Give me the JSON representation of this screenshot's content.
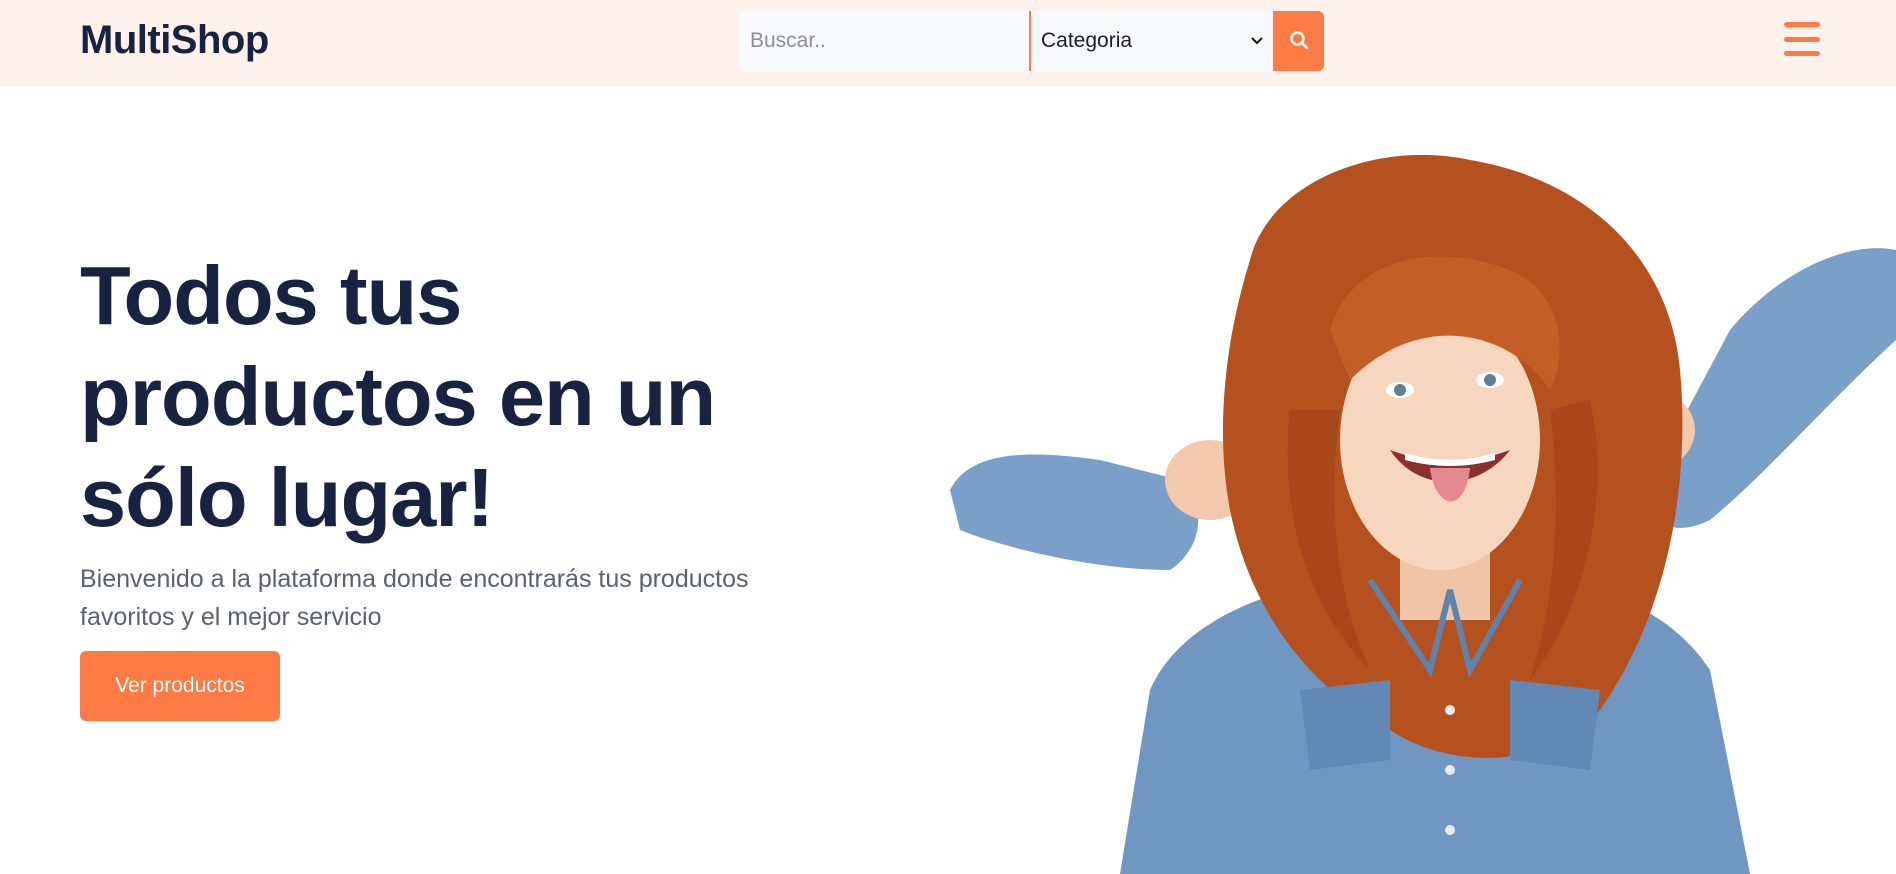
{
  "brand": {
    "name": "MultiShop"
  },
  "search": {
    "placeholder": "Buscar..",
    "category_selected": "Categoria"
  },
  "hero": {
    "title": "Todos tus productos en un sólo lugar!",
    "subtitle": "Bienvenido a la plataforma donde encontrarás tus productos favoritos y el mejor servicio",
    "cta_label": "Ver productos"
  },
  "icons": {
    "search": "search-icon",
    "menu": "hamburger-menu-icon",
    "dropdown": "chevron-down-icon"
  },
  "colors": {
    "accent": "#ff7b45",
    "navbar_bg": "#fff1eb",
    "heading": "#172340",
    "body_text": "#5a6270"
  }
}
